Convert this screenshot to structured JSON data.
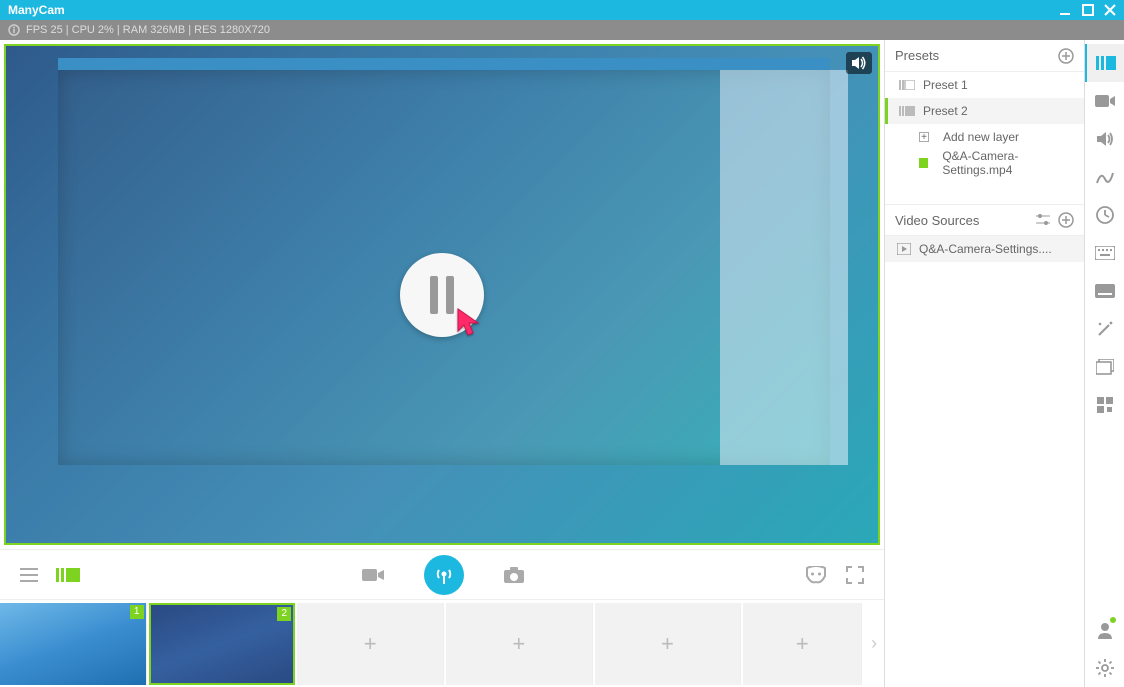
{
  "app": {
    "title": "ManyCam"
  },
  "status": {
    "text": "FPS 25 | CPU 2% | RAM 326MB | RES 1280X720"
  },
  "presets": {
    "header": "Presets",
    "items": [
      {
        "label": "Preset 1"
      },
      {
        "label": "Preset 2"
      }
    ],
    "add_layer": "Add new layer",
    "file": "Q&A-Camera-Settings.mp4"
  },
  "video_sources": {
    "header": "Video Sources",
    "item": "Q&A-Camera-Settings...."
  },
  "thumbs": {
    "slot1_num": "1",
    "slot2_num": "2"
  },
  "icons": {
    "hamburger": "hamburger-icon",
    "transition": "transition-icon",
    "camera": "camera-icon",
    "broadcast": "broadcast-icon",
    "snapshot": "snapshot-icon",
    "mask": "mask-icon",
    "fullscreen": "fullscreen-icon"
  }
}
